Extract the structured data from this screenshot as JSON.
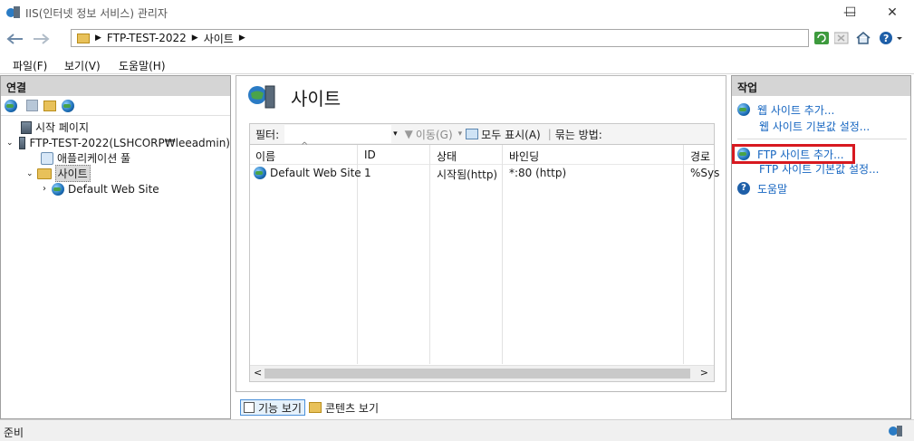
{
  "window": {
    "title": "IIS(인터넷 정보 서비스) 관리자",
    "minimize_glyph": "—",
    "maximize_glyph": "☐",
    "close_glyph": "✕"
  },
  "address": {
    "crumbs": [
      "FTP-TEST-2022",
      "사이트"
    ],
    "separator": "▶"
  },
  "menu": [
    "파일(F)",
    "보기(V)",
    "도움말(H)"
  ],
  "connections": {
    "title": "연결",
    "tree": [
      {
        "label": "시작 페이지"
      },
      {
        "label": "FTP-TEST-2022(LSHCORP₩leeadmin)"
      },
      {
        "label": "애플리케이션 풀"
      },
      {
        "label": "사이트"
      },
      {
        "label": "Default Web Site"
      }
    ]
  },
  "main": {
    "title": "사이트",
    "filter_label": "필터:",
    "go_label": "이동(G)",
    "show_all_label": "모두 표시(A)",
    "group_label": "묶는 방법:",
    "columns": [
      "이름",
      "ID",
      "상태",
      "바인딩",
      "경로"
    ],
    "rows": [
      {
        "name": "Default Web Site",
        "id": "1",
        "status": "시작됨(http)",
        "binding": "*:80 (http)",
        "path": "%Sys"
      }
    ],
    "features_view": "기능 보기",
    "content_view": "콘텐츠 보기"
  },
  "actions": {
    "title": "작업",
    "add_web_site": "웹 사이트 추가...",
    "web_defaults": "웹 사이트 기본값 설정...",
    "add_ftp_site": "FTP 사이트 추가...",
    "ftp_defaults": "FTP 사이트 기본값 설정...",
    "help": "도움말"
  },
  "status": {
    "text": "준비"
  },
  "colors": {
    "panel_header": "#d5d5d5",
    "link": "#1565c0",
    "highlight": "#d71920"
  }
}
